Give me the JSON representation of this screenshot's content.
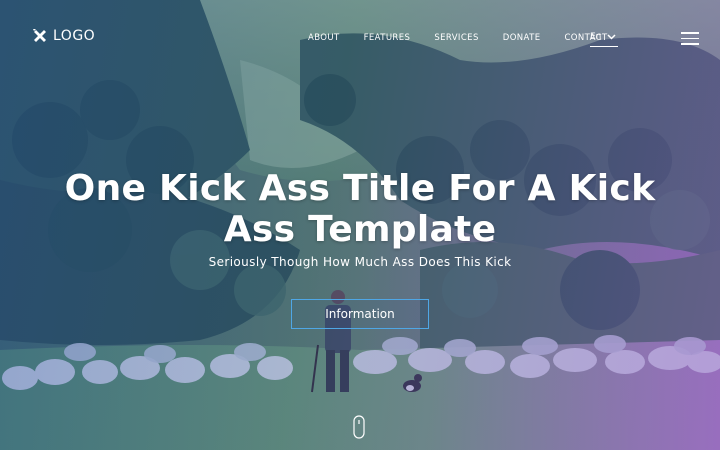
{
  "brand": {
    "logo_text": "LOGO",
    "logo_icon": "crossed-tools-icon"
  },
  "nav": {
    "items": [
      {
        "label": "ABOUT"
      },
      {
        "label": "FEATURES"
      },
      {
        "label": "SERVICES"
      },
      {
        "label": "DONATE"
      },
      {
        "label": "CONTACT"
      }
    ],
    "language": "En",
    "language_icon": "chevron-down-icon",
    "menu_icon": "hamburger-menu-icon"
  },
  "hero": {
    "title": "One Kick Ass Title For A Kick Ass Template",
    "subtitle": "Seriously Though How Much Ass Does This Kick",
    "cta_label": "Information",
    "scroll_icon": "mouse-scroll-icon"
  },
  "colors": {
    "text": "#ffffff",
    "button_border": "#4fa7e6",
    "overlay_left": "#2646c8",
    "overlay_right": "#965adc"
  }
}
